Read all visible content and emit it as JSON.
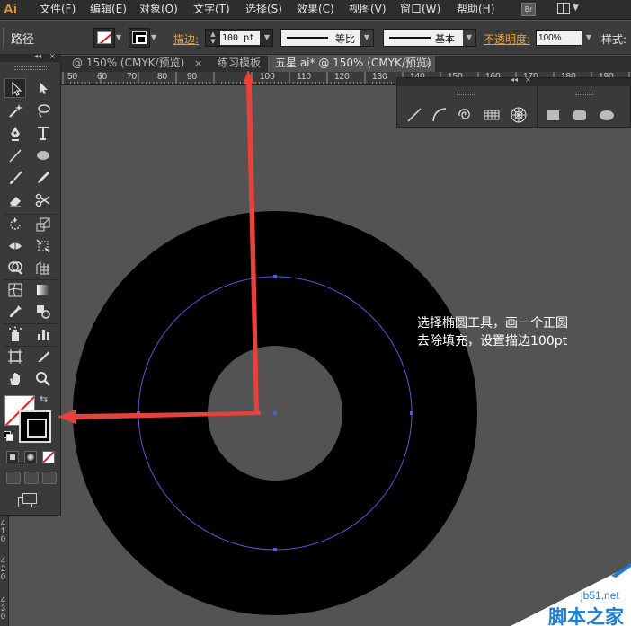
{
  "app": {
    "logo_text": "Ai",
    "menus": [
      "文件(F)",
      "编辑(E)",
      "对象(O)",
      "文字(T)",
      "选择(S)",
      "效果(C)",
      "视图(V)",
      "窗口(W)",
      "帮助(H)"
    ],
    "bridge_label": "Br"
  },
  "control_bar": {
    "object_type": "路径",
    "stroke_label": "描边:",
    "stroke_weight": "100 pt",
    "profile_label": "等比",
    "brush_label": "基本",
    "opacity_label": "不透明度:",
    "opacity_value": "100%",
    "style_label": "样式:"
  },
  "tabs": [
    {
      "title": "@ 150% (CMYK/预览)",
      "active": false
    },
    {
      "title": "练习模板",
      "active": false
    },
    {
      "title": "五星.ai* @ 150% (CMYK/预览)",
      "active": true
    }
  ],
  "tab_close": "×",
  "ruler": {
    "labels": [
      "50",
      "60",
      "70",
      "80",
      "90",
      "100",
      "110",
      "120",
      "130",
      "140",
      "150",
      "160",
      "170",
      "180",
      "190"
    ],
    "vertical_labels": [
      "4",
      "1",
      "0",
      "4",
      "2",
      "0",
      "4",
      "3",
      "0"
    ]
  },
  "annotation": {
    "line1": "选择椭圆工具，画一个正圆",
    "line2": "去除填充，设置描边100pt"
  },
  "watermark": {
    "small": "jb51.net",
    "big": "脚本之家"
  },
  "colors": {
    "accent_orange": "#e7a23c",
    "arrow_red": "#e8403a",
    "path_blue": "#4a5ed8",
    "watermark_blue": "#1a7fd6"
  },
  "icons": {
    "tools": [
      "selection-tool",
      "direct-selection-tool",
      "magic-wand-tool",
      "lasso-tool",
      "pen-tool",
      "type-tool",
      "line-segment-tool",
      "ellipse-tool",
      "paintbrush-tool",
      "pencil-tool",
      "eraser-tool",
      "scissors-tool",
      "rotate-tool",
      "scale-tool",
      "width-tool",
      "free-transform-tool",
      "shape-builder-tool",
      "perspective-grid-tool",
      "mesh-tool",
      "gradient-tool",
      "eyedropper-tool",
      "blend-tool",
      "symbol-sprayer-tool",
      "column-graph-tool",
      "artboard-tool",
      "slice-tool",
      "hand-tool",
      "zoom-tool"
    ],
    "panel": [
      "line-tool",
      "arc-tool",
      "spiral-tool",
      "rectangular-grid-tool",
      "polar-grid-tool",
      "rectangle-tool",
      "rounded-rectangle-tool",
      "ellipse-tool"
    ]
  }
}
